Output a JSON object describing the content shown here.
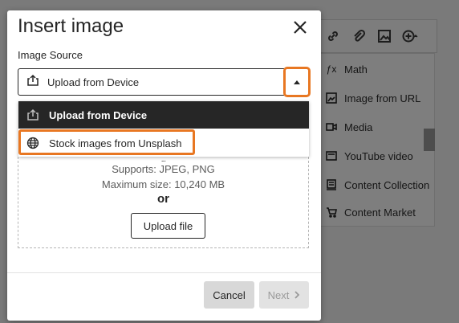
{
  "background": {
    "menu_items": [
      {
        "label": "Math",
        "icon": "math-icon"
      },
      {
        "label": "Image from URL",
        "icon": "image-url-icon"
      },
      {
        "label": "Media",
        "icon": "media-icon"
      },
      {
        "label": "YouTube video",
        "icon": "youtube-icon"
      },
      {
        "label": "Content Collection",
        "icon": "content-collection-icon"
      },
      {
        "label": "Content Market",
        "icon": "content-market-icon"
      }
    ],
    "toolbar_icons": [
      "link-icon",
      "attach-icon",
      "image-icon",
      "insert-plus-icon"
    ]
  },
  "modal": {
    "title": "Insert image",
    "field_label": "Image Source",
    "select_value": "Upload from Device",
    "options": [
      {
        "label": "Upload from Device",
        "selected": true
      },
      {
        "label": "Stock images from Unsplash",
        "selected": false
      }
    ],
    "dropzone": {
      "supports": "Supports: JPEG, PNG",
      "max_size": "Maximum size: 10,240 MB",
      "or_label": "or",
      "upload_button": "Upload file"
    },
    "cancel_label": "Cancel",
    "next_label": "Next"
  },
  "colors": {
    "highlight": "#e87722",
    "selected_option_bg": "#262626"
  }
}
